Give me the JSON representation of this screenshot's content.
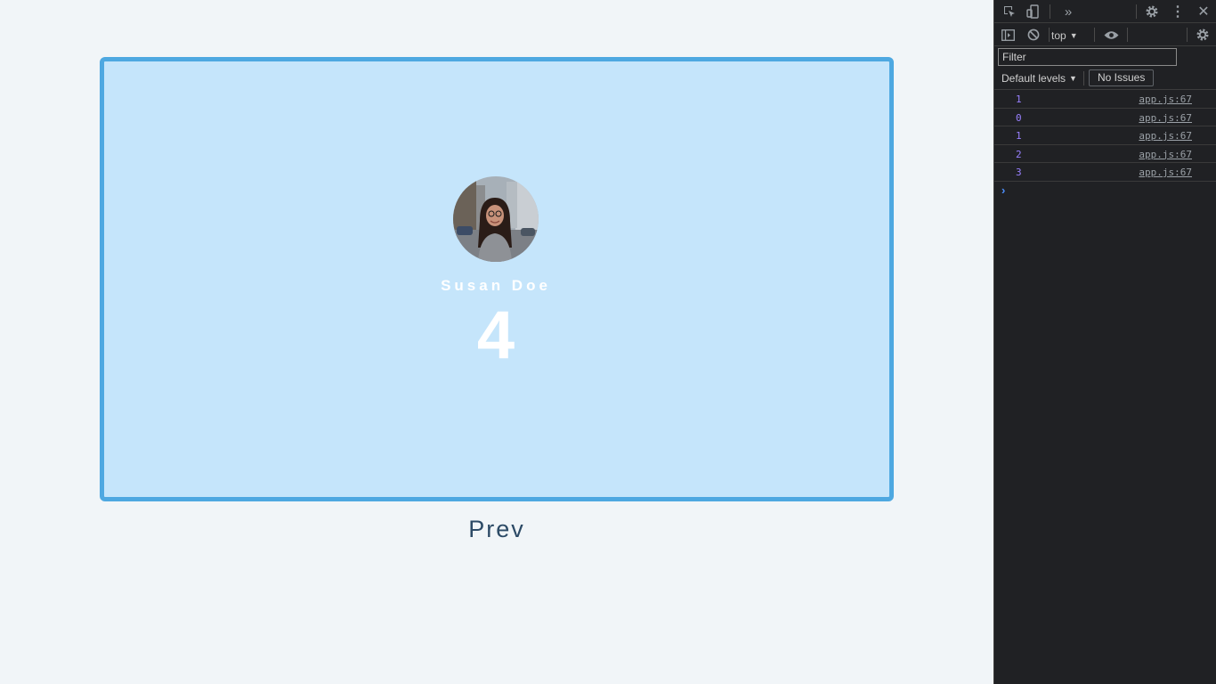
{
  "card": {
    "person_name": "Susan Doe",
    "count": "4"
  },
  "prev_label": "Prev",
  "devtools": {
    "context": "top",
    "filter_placeholder": "Filter",
    "levels_label": "Default levels",
    "issues_label": "No Issues",
    "logs": [
      {
        "value": "1",
        "source": "app.js:67"
      },
      {
        "value": "0",
        "source": "app.js:67"
      },
      {
        "value": "1",
        "source": "app.js:67"
      },
      {
        "value": "2",
        "source": "app.js:67"
      },
      {
        "value": "3",
        "source": "app.js:67"
      }
    ],
    "icons": {
      "inspect": "inspect-element-icon",
      "device": "device-toolbar-icon",
      "more_tabs": "more-tabs-icon",
      "settings": "settings-gear-icon",
      "menu": "kebab-menu-icon",
      "close": "close-icon",
      "sidebar": "sidebar-toggle-icon",
      "clear": "clear-console-icon",
      "eye": "live-expression-eye-icon"
    }
  },
  "colors": {
    "card_bg": "#c5e5fb",
    "card_border": "#4ea8e1",
    "log_value": "#9980ff",
    "devtools_bg": "#202124"
  }
}
